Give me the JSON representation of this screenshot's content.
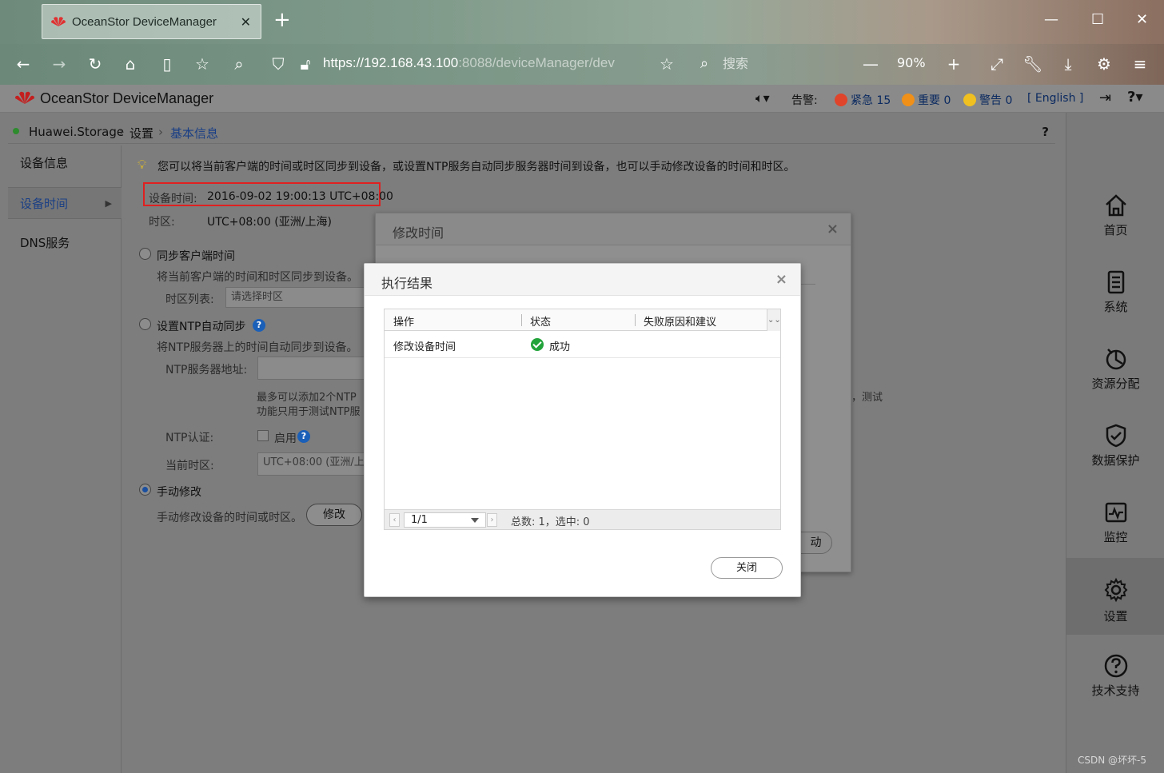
{
  "browser": {
    "tab_title": "OceanStor DeviceManager",
    "url_host": "https://192.168.43.100",
    "url_rest": ":8088/deviceManager/dev",
    "search_placeholder": "搜索",
    "zoom": "90%"
  },
  "app": {
    "title": "OceanStor DeviceManager",
    "alarm_label": "告警:",
    "alarm_critical": "紧急 15",
    "alarm_major": "重要 0",
    "alarm_warning": "警告 0",
    "language": "[ English ]",
    "colors": {
      "critical": "#e0442a",
      "major": "#f09018",
      "warning": "#f0c020",
      "accent": "#1a4fa0"
    }
  },
  "breadcrumb": {
    "root": "Huawei.Storage",
    "level1": "设置",
    "current": "基本信息",
    "help": "?"
  },
  "leftnav": {
    "items": [
      "设备信息",
      "设备时间",
      "DNS服务"
    ],
    "active": "设备时间"
  },
  "content": {
    "tip": "您可以将当前客户端的时间或时区同步到设备，或设置NTP服务自动同步服务器时间到设备，也可以手动修改设备的时间和时区。",
    "device_time_label": "设备时间:",
    "device_time_value": "2016-09-02 19:00:13 UTC+08:00",
    "timezone_label": "时区:",
    "timezone_value": "UTC+08:00 (亚洲/上海)",
    "sync_client": {
      "label": "同步客户端时间",
      "desc": "将当前客户端的时间和时区同步到设备。",
      "tz_list_label": "时区列表:",
      "tz_placeholder": "请选择时区"
    },
    "ntp": {
      "label": "设置NTP自动同步",
      "desc": "将NTP服务器上的时间自动同步到设备。",
      "server_label": "NTP服务器地址:",
      "note1": "最多可以添加2个NTP",
      "note2": "功能只用于测试NTP服",
      "note_tail": "，测试",
      "auth_label": "NTP认证:",
      "auth_enable": "启用",
      "current_tz_label": "当前时区:",
      "current_tz_value": "UTC+08:00 (亚洲/上"
    },
    "manual": {
      "label": "手动修改",
      "desc": "手动修改设备的时间或时区。",
      "button": "修改"
    }
  },
  "rightbar": {
    "items": [
      "首页",
      "系统",
      "资源分配",
      "数据保护",
      "监控",
      "设置",
      "技术支持"
    ],
    "active": "设置"
  },
  "dialog_bg": {
    "title": "修改时间",
    "partial_button": "动"
  },
  "dialog": {
    "title": "执行结果",
    "columns": [
      "操作",
      "状态",
      "失败原因和建议"
    ],
    "rows": [
      {
        "operation": "修改设备时间",
        "status": "成功",
        "reason": ""
      }
    ],
    "pager": {
      "page": "1/1",
      "info": "总数: 1，选中: 0"
    },
    "close_button": "关闭"
  },
  "watermark": "CSDN @坏坏-5"
}
